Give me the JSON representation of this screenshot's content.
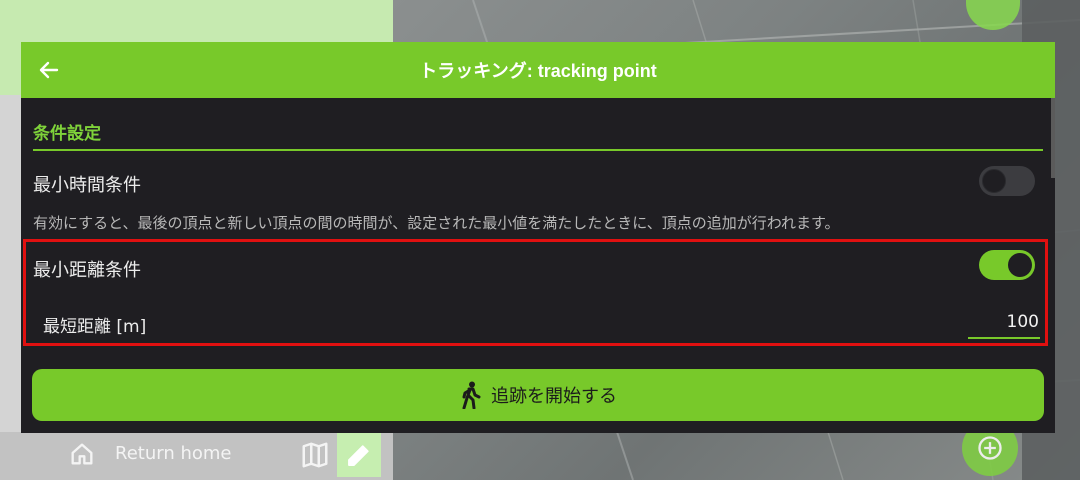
{
  "dialog": {
    "title": "トラッキング: tracking point",
    "back_icon": "arrow-left-icon",
    "section_title": "条件設定",
    "min_time": {
      "label": "最小時間条件",
      "enabled": false,
      "description": "有効にすると、最後の頂点と新しい頂点の間の時間が、設定された最小値を満たしたときに、頂点の追加が行われます。"
    },
    "min_distance": {
      "label": "最小距離条件",
      "enabled": true,
      "field_label": "最短距離 [m]",
      "field_value": "100"
    },
    "start_button": {
      "label": "追跡を開始する",
      "icon": "walking-person-icon"
    }
  },
  "background": {
    "return_home_label": "Return home",
    "icons": [
      "home-icon",
      "map-icon",
      "pencil-icon",
      "plus-circle-icon"
    ]
  },
  "colors": {
    "accent": "#78c92a",
    "dialog_bg": "#1f1e22",
    "highlight": "#e01010"
  }
}
